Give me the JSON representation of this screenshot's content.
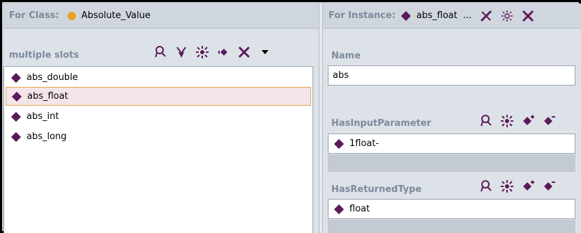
{
  "class_panel": {
    "header_label": "For Class:",
    "class_name": "Absolute_Value",
    "slots_label": "multiple slots",
    "toolbar_icons": [
      "view-slot-icon",
      "add-slot-icon",
      "create-slot-icon",
      "remove-slot-icon",
      "delete-slot-icon",
      "menu-dropdown-icon"
    ],
    "items": [
      {
        "label": "abs_double",
        "selected": false
      },
      {
        "label": "abs_float",
        "selected": true
      },
      {
        "label": "abs_int",
        "selected": false
      },
      {
        "label": "abs_long",
        "selected": false
      }
    ]
  },
  "instance_panel": {
    "header_label": "For Instance:",
    "instance_name": "abs_float",
    "ellipsis": "...",
    "header_icons": [
      "references-icon",
      "settings-icon",
      "close-icon"
    ],
    "name_label": "Name",
    "name_value": "abs",
    "input_param_label": "HasInputParameter",
    "input_param_value": "1float-",
    "returned_type_label": "HasReturnedType",
    "returned_type_value": "float"
  },
  "colors": {
    "class_dot": "#e6a31e",
    "instance_diamond": "#5a1b5a",
    "label_text": "#7c8a9c",
    "selection_bg": "#f4e5e8",
    "selection_border": "#e6a544"
  }
}
